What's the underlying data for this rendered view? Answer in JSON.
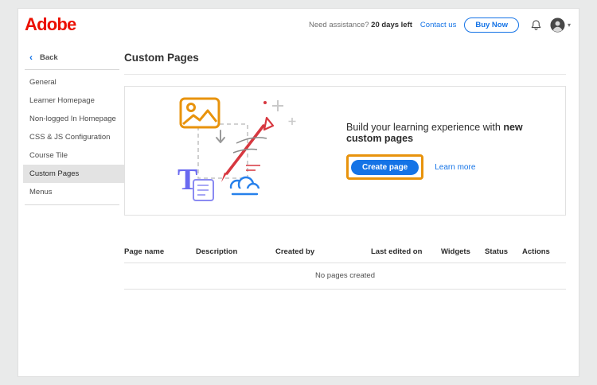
{
  "header": {
    "logo": "Adobe",
    "assistance_prefix": "Need assistance? ",
    "days_left": "20 days left",
    "contact_link": "Contact us",
    "buy_now_label": "Buy Now"
  },
  "sidebar": {
    "back_label": "Back",
    "items": [
      {
        "label": "General",
        "selected": false
      },
      {
        "label": "Learner Homepage",
        "selected": false
      },
      {
        "label": "Non-logged In Homepage",
        "selected": false
      },
      {
        "label": "CSS & JS Configuration",
        "selected": false
      },
      {
        "label": "Course Tile",
        "selected": false
      },
      {
        "label": "Custom Pages",
        "selected": true
      },
      {
        "label": "Menus",
        "selected": false
      }
    ]
  },
  "main": {
    "title": "Custom Pages",
    "hero": {
      "message_prefix": "Build your learning experience with ",
      "message_bold": "new custom pages",
      "create_button_label": "Create page",
      "learn_more_label": "Learn more"
    },
    "table": {
      "headers": [
        "Page name",
        "Description",
        "Created by",
        "Last edited on",
        "Widgets",
        "Status",
        "Actions"
      ],
      "empty_text": "No pages created"
    }
  },
  "colors": {
    "adobe_red": "#EB1000",
    "link_blue": "#1473E6",
    "button_blue": "#1473E6",
    "highlight_orange": "#E8930C",
    "selected_item_bg": "#E3E3E3"
  },
  "icons": {
    "bell": "notification-bell-icon",
    "avatar": "user-avatar",
    "back_chevron": "chevron-left-icon",
    "account_chevron": "chevron-down-icon"
  }
}
